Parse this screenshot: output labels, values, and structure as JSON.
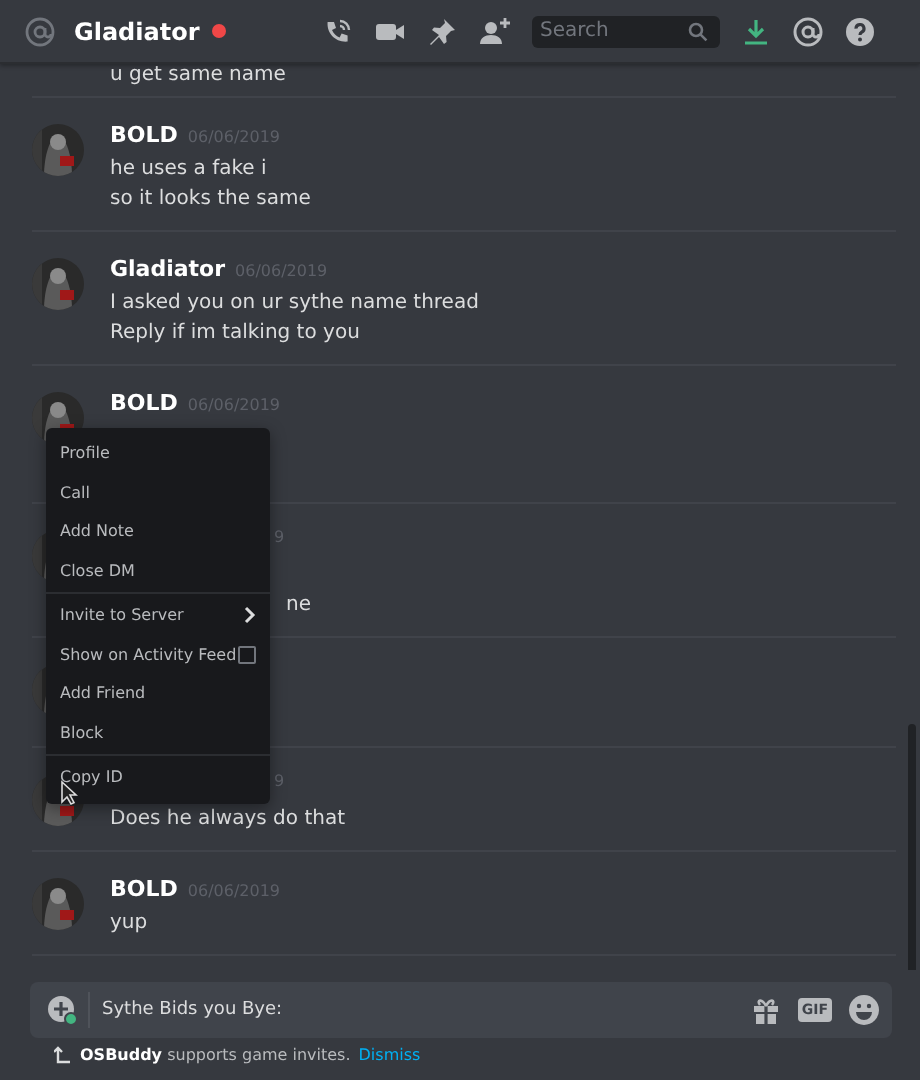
{
  "header": {
    "title": "Gladiator",
    "search": {
      "placeholder": "Search"
    }
  },
  "messages": [
    {
      "kind": "top",
      "lines": [
        "u get same name"
      ]
    },
    {
      "kind": "full",
      "author": "BOLD",
      "time": "06/06/2019",
      "lines": [
        "he uses a fake i",
        "so it looks the same"
      ]
    },
    {
      "kind": "full",
      "author": "Gladiator",
      "time": "06/06/2019",
      "lines": [
        "I asked you on ur sythe name thread",
        "Reply if im talking to you"
      ]
    },
    {
      "kind": "full",
      "author": "BOLD",
      "time": "06/06/2019"
    },
    {
      "kind": "covered",
      "time": "9",
      "lines": [
        "ne"
      ]
    },
    {
      "kind": "covered"
    },
    {
      "kind": "partial",
      "time": "9",
      "lines": [
        "Does he always do that"
      ]
    },
    {
      "kind": "full",
      "author": "BOLD",
      "time": "06/06/2019",
      "lines": [
        "yup"
      ]
    }
  ],
  "context_menu": {
    "sections": [
      [
        {
          "label": "Profile",
          "kind": "item"
        },
        {
          "label": "Call",
          "kind": "item"
        },
        {
          "label": "Add Note",
          "kind": "item"
        },
        {
          "label": "Close DM",
          "kind": "item"
        }
      ],
      [
        {
          "label": "Invite to Server",
          "kind": "submenu"
        },
        {
          "label": "Show on Activity Feed",
          "kind": "checkbox",
          "checked": false
        },
        {
          "label": "Add Friend",
          "kind": "item"
        },
        {
          "label": "Block",
          "kind": "item"
        }
      ],
      [
        {
          "label": "Copy ID",
          "kind": "item"
        }
      ]
    ]
  },
  "composer": {
    "value": "Sythe Bids you Bye:",
    "gif_label": "GIF"
  },
  "notice": {
    "text": "**OSBuddy** supports game invites.",
    "action": "Dismiss"
  }
}
